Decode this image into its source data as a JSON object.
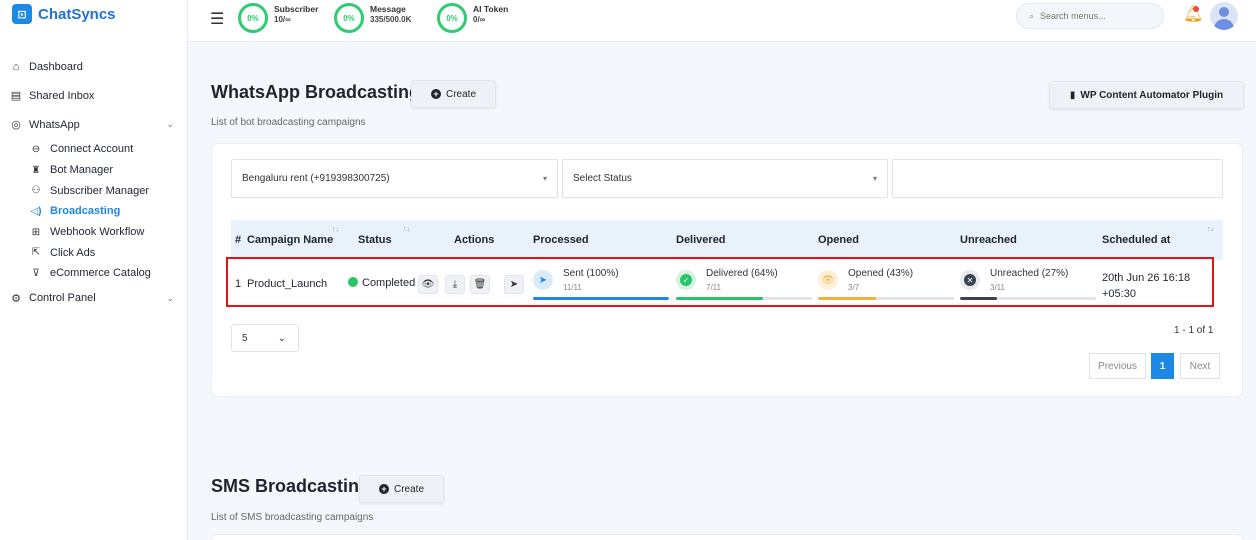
{
  "brand": {
    "name": "ChatSyncs",
    "logo_glyph": "⊡"
  },
  "topbar": {
    "stats": [
      {
        "percent": "0%",
        "title": "Subscriber",
        "value": "10/∞"
      },
      {
        "percent": "0%",
        "title": "Message",
        "value": "335/500.0K"
      },
      {
        "percent": "0%",
        "title": "AI Token",
        "value": "0/∞"
      }
    ],
    "search_placeholder": "Search menus..."
  },
  "sidebar": {
    "items": [
      {
        "label": "Dashboard"
      },
      {
        "label": "Shared Inbox"
      },
      {
        "label": "WhatsApp"
      },
      {
        "label": "Control Panel"
      }
    ],
    "whatsapp_sub": [
      {
        "label": "Connect Account"
      },
      {
        "label": "Bot Manager"
      },
      {
        "label": "Subscriber Manager"
      },
      {
        "label": "Broadcasting"
      },
      {
        "label": "Webhook Workflow"
      },
      {
        "label": "Click Ads"
      },
      {
        "label": "eCommerce Catalog"
      }
    ]
  },
  "whatsapp_section": {
    "title": "WhatsApp Broadcasting",
    "create_label": "Create",
    "subtitle": "List of bot broadcasting campaigns",
    "plugin_label": "WP Content Automator Plugin",
    "filter_bot": "Bengaluru rent (+919398300725)",
    "filter_status": "Select Status",
    "filter_search": ""
  },
  "table": {
    "headers": [
      "#",
      "Campaign Name",
      "Status",
      "Actions",
      "Processed",
      "Delivered",
      "Opened",
      "Unreached",
      "Scheduled at"
    ],
    "row": {
      "index": "1",
      "name": "Product_Launch",
      "status": "Completed",
      "processed_label": "Sent (100%)",
      "processed_count": "11/11",
      "processed_pct": 100,
      "delivered_label": "Delivered (64%)",
      "delivered_count": "7/11",
      "delivered_pct": 64,
      "opened_label": "Opened (43%)",
      "opened_count": "3/7",
      "opened_pct": 43,
      "unreached_label": "Unreached (27%)",
      "unreached_count": "3/11",
      "unreached_pct": 27,
      "scheduled_line1": "20th Jun 26 16:18",
      "scheduled_line2": "+05:30"
    }
  },
  "pagination": {
    "page_size": "5",
    "range": "1 - 1 of 1",
    "previous": "Previous",
    "current": "1",
    "next": "Next"
  },
  "sms_section": {
    "title": "SMS Broadcasting",
    "create_label": "Create",
    "subtitle": "List of SMS broadcasting campaigns"
  },
  "colors": {
    "accent": "#1e88e5",
    "processed": "#1e88e5",
    "delivered": "#27c46a",
    "opened": "#f0b13a",
    "unreached": "#3b4252",
    "highlight": "#e0141a"
  }
}
